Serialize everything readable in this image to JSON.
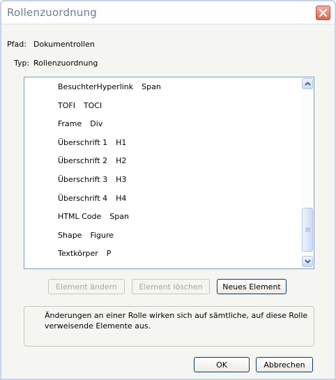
{
  "window": {
    "title": "Rollenzuordnung"
  },
  "info": {
    "path_label": "Pfad:",
    "path_value": "Dokumentrollen",
    "type_label": "Typ:",
    "type_value": "Rollenzuordnung"
  },
  "list": {
    "items": [
      {
        "name": "BesuchterHyperlink",
        "role": "Span"
      },
      {
        "name": "TOFI",
        "role": "TOCI"
      },
      {
        "name": "Frame",
        "role": "Div"
      },
      {
        "name": "Überschrift 1",
        "role": "H1"
      },
      {
        "name": "Überschrift 2",
        "role": "H2"
      },
      {
        "name": "Überschrift 3",
        "role": "H3"
      },
      {
        "name": "Überschrift 4",
        "role": "H4"
      },
      {
        "name": "HTML Code",
        "role": "Span"
      },
      {
        "name": "Shape",
        "role": "Figure"
      },
      {
        "name": "Textkörper",
        "role": "P"
      }
    ]
  },
  "buttons": {
    "edit": "Element ändern",
    "delete": "Element löschen",
    "new": "Neues Element",
    "ok": "OK",
    "cancel": "Abbrechen"
  },
  "note": "Änderungen an einer Rolle wirken sich auf sämtliche, auf diese Rolle verweisende Elemente aus."
}
